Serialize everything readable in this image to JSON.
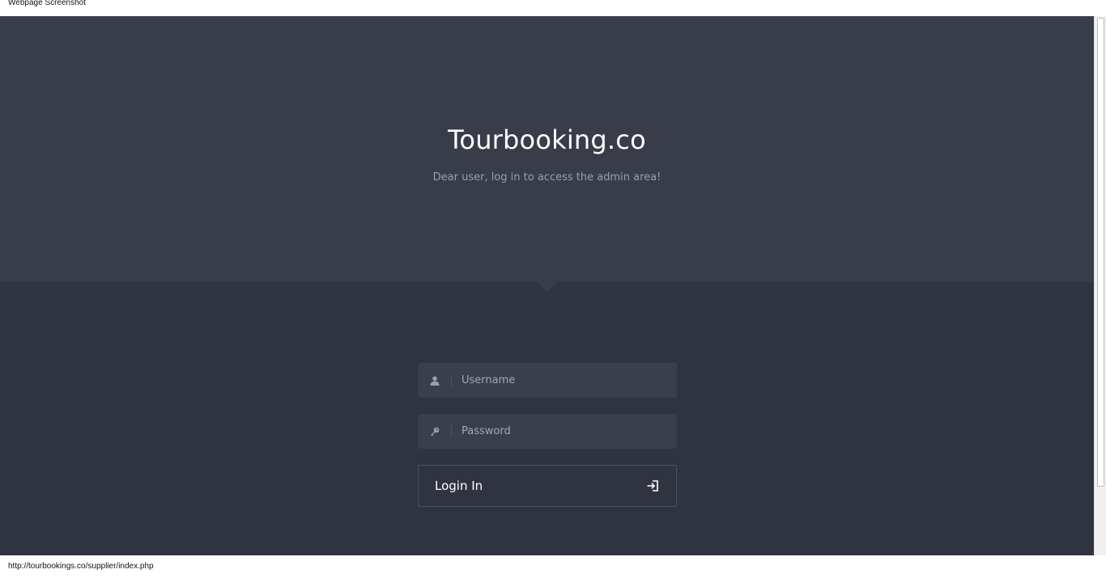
{
  "caption": "Webpage Screenshot",
  "hero": {
    "title": "Tourbooking.co",
    "subtitle": "Dear user, log in to access the admin area!"
  },
  "form": {
    "username": {
      "placeholder": "Username",
      "value": "",
      "icon": "user-icon"
    },
    "password": {
      "placeholder": "Password",
      "value": "",
      "icon": "key-icon"
    },
    "login_button": {
      "label": "Login In",
      "icon": "sign-in-icon"
    }
  },
  "status_bar": {
    "url": "http://tourbookings.co/supplier/index.php"
  },
  "colors": {
    "hero_bg": "#383d49",
    "page_bg": "#2f3440",
    "field_bg": "#3a3f4b",
    "title_text": "#ffffff",
    "subtitle_text": "#9aa0ab"
  }
}
